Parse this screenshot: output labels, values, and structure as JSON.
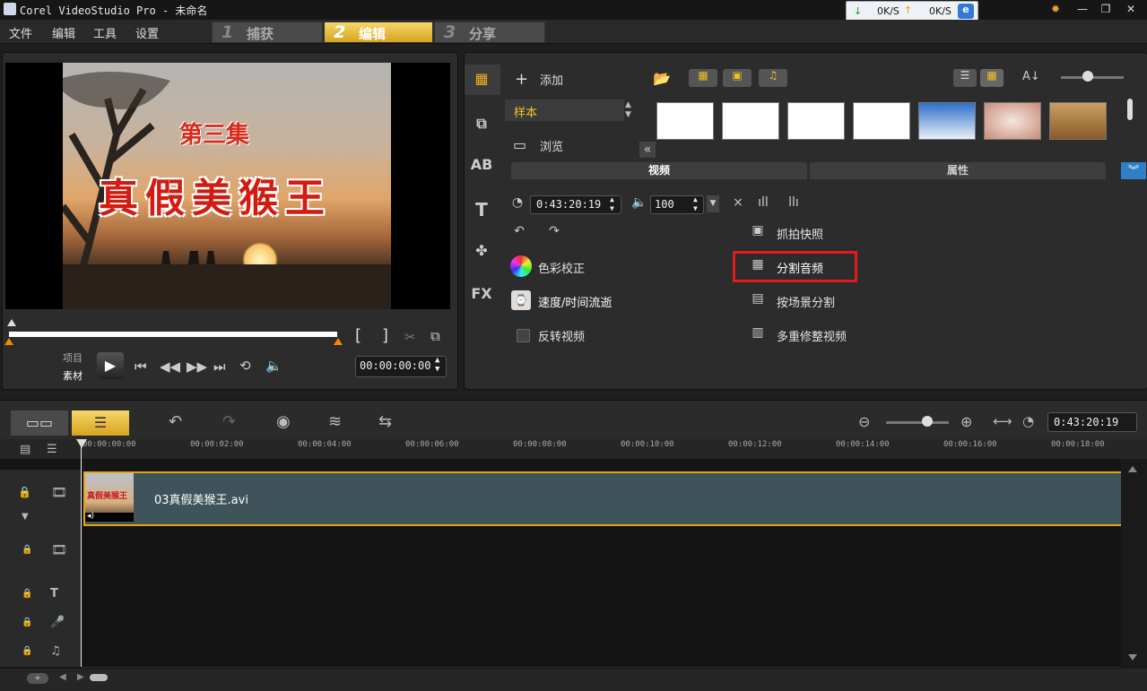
{
  "window": {
    "title": "Corel VideoStudio Pro - 未命名",
    "net_down": "0K/S",
    "net_up": "0K/S"
  },
  "menu": [
    "文件",
    "编辑",
    "工具",
    "设置"
  ],
  "steps": [
    {
      "num": "1",
      "label": "捕获",
      "active": false
    },
    {
      "num": "2",
      "label": "编辑",
      "active": true
    },
    {
      "num": "3",
      "label": "分享",
      "active": false
    }
  ],
  "preview": {
    "episode_text": "第三集",
    "title_text": "真假美猴王",
    "mode_project": "项目",
    "mode_clip": "素材",
    "timecode": "00:00:00:00",
    "mark_in": "[",
    "mark_out": "]"
  },
  "library": {
    "add_label": "添加",
    "sample_label": "样本",
    "browse_label": "浏览",
    "tab_video": "视频",
    "tab_attributes": "属性",
    "duration": "0:43:20:19",
    "volume": "100",
    "options_left": [
      "色彩校正",
      "速度/时间流逝",
      "反转视频"
    ],
    "options_right": [
      "抓拍快照",
      "分割音频",
      "按场景分割",
      "多重修整视频"
    ]
  },
  "timeline": {
    "timecode": "0:43:20:19",
    "ruler": [
      "00:00:00:00",
      "00:00:02:00",
      "00:00:04:00",
      "00:00:06:00",
      "00:00:08:00",
      "00:00:10:00",
      "00:00:12:00",
      "00:00:14:00",
      "00:00:16:00",
      "00:00:18:00"
    ],
    "clip_name": "03真假美猴王.avi",
    "clip_thumb_text": "真假美猴王",
    "zoom_sign": "+/−"
  },
  "colors": {
    "accent": "#e6a800",
    "highlight_box": "#e21b1b",
    "sample_text": "#f2c62a"
  }
}
